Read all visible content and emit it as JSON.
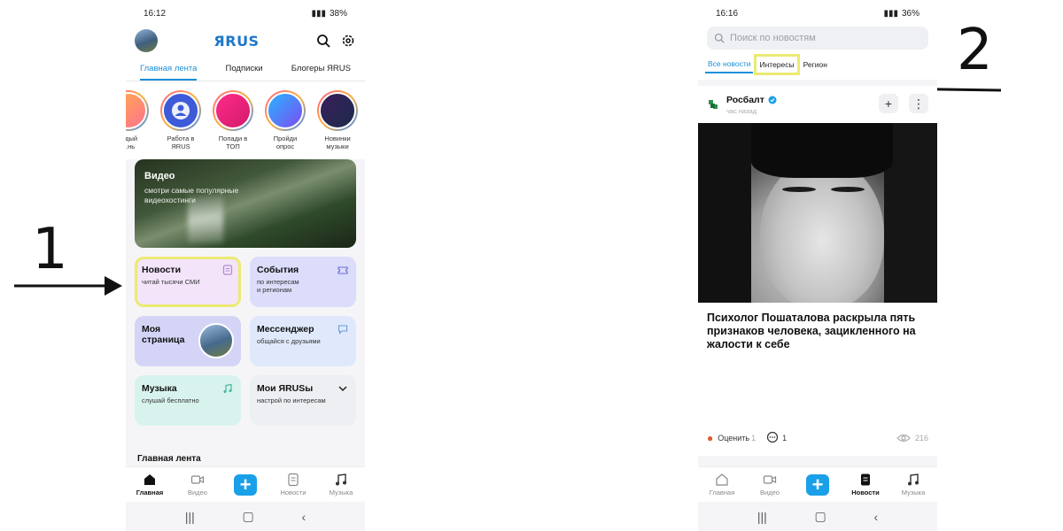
{
  "annotations": {
    "left_number": "1",
    "right_number": "2"
  },
  "phone1": {
    "status": {
      "time": "16:12",
      "battery": "38%"
    },
    "logo": "ЯRUS",
    "tabs": [
      "Главная лента",
      "Подписки",
      "Блогеры ЯRUS"
    ],
    "stories": [
      {
        "label": "...дый\n...нь"
      },
      {
        "label": "Работа в\nЯRUS"
      },
      {
        "label": "Попади в\nТОП"
      },
      {
        "label": "Пройди\nопрос"
      },
      {
        "label": "Новинки\nмузыки"
      }
    ],
    "video": {
      "title": "Видео",
      "subtitle": "смотри самые популярные видеохостинги"
    },
    "tiles": [
      {
        "title": "Новости",
        "subtitle": "читай тысячи СМИ",
        "color": "#f3e4fa"
      },
      {
        "title": "События",
        "subtitle": "по интересам\nи регионам",
        "color": "#dcdcfb"
      },
      {
        "title": "Моя\nстраница",
        "subtitle": "",
        "color": "#d4d4f7"
      },
      {
        "title": "Мессенджер",
        "subtitle": "общайся с друзьями",
        "color": "#dfe9fb"
      },
      {
        "title": "Музыка",
        "subtitle": "слушай бесплатно",
        "color": "#d8f3ee"
      },
      {
        "title": "Мои ЯRUSы",
        "subtitle": "настрой по интересам",
        "color": "#eeeff3"
      }
    ],
    "section_title": "Главная лента",
    "nav": [
      "Главная",
      "Видео",
      "Новости",
      "Музыка"
    ]
  },
  "phone2": {
    "status": {
      "time": "16:16",
      "battery": "36%"
    },
    "search_placeholder": "Поиск по новостям",
    "tabs": [
      "Все новости",
      "Интересы",
      "Регион"
    ],
    "post": {
      "source": "Росбалт",
      "time": "час назад",
      "headline": "Психолог Пошаталова раскрыла пять признаков человека, зацикленного на жалости к себе",
      "rate_label": "Оценить",
      "rate_count": "1",
      "comments": "1",
      "views": "216"
    },
    "nav": [
      "Главная",
      "Видео",
      "Новости",
      "Музыка"
    ]
  }
}
